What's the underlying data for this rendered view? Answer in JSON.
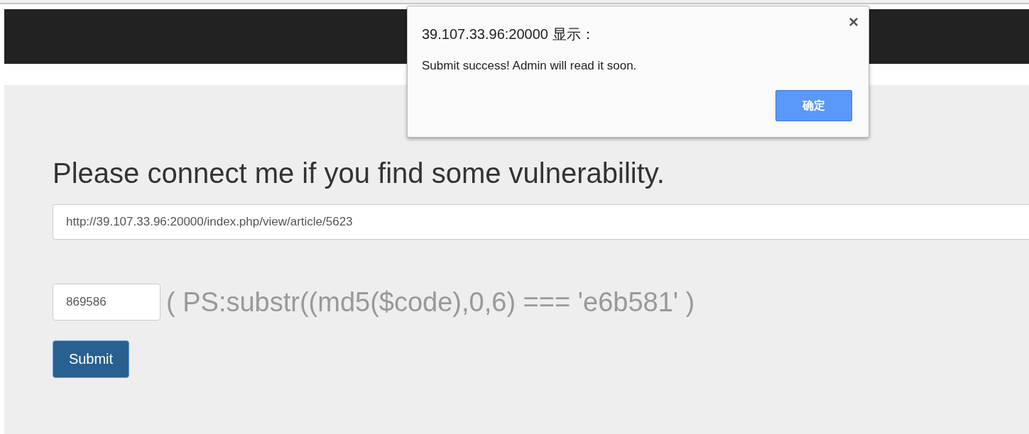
{
  "page": {
    "heading": "Please connect me if you find some vulnerability.",
    "url_field": {
      "value": "http://39.107.33.96:20000/index.php/view/article/5623"
    },
    "code_field": {
      "value": "869586"
    },
    "hint": "( PS:substr((md5($code),0,6) === 'e6b581' )",
    "submit_button": "Submit"
  },
  "dialog": {
    "title": "39.107.33.96:20000 显示：",
    "close": "×",
    "message": "Submit success! Admin will read it soon.",
    "ok_button": "确定"
  }
}
